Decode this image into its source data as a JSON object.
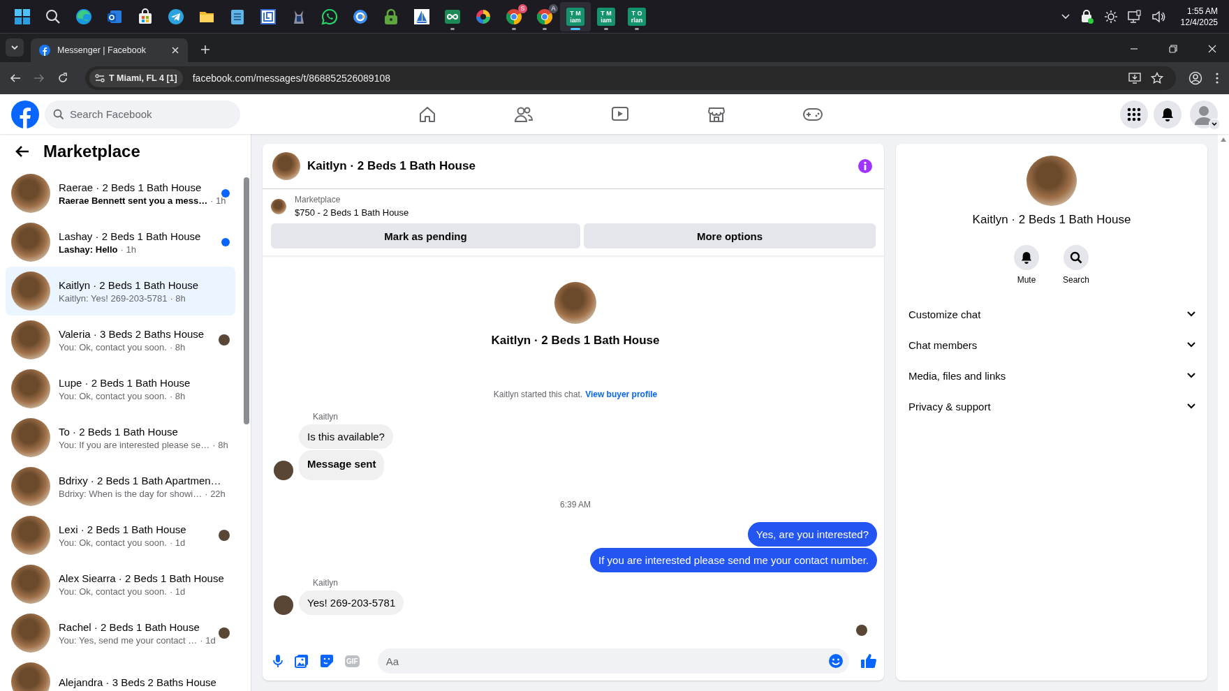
{
  "taskbar": {
    "apps": [
      {
        "kind": "start",
        "selected": false,
        "running": false
      },
      {
        "kind": "search",
        "selected": false,
        "running": false
      },
      {
        "kind": "edge",
        "selected": false,
        "running": false
      },
      {
        "kind": "outlook",
        "selected": false,
        "running": false
      },
      {
        "kind": "store",
        "selected": false,
        "running": false
      },
      {
        "kind": "telegram",
        "selected": false,
        "running": false
      },
      {
        "kind": "files",
        "selected": false,
        "running": false
      },
      {
        "kind": "notepad",
        "selected": false,
        "running": false
      },
      {
        "kind": "maze",
        "selected": false,
        "running": false
      },
      {
        "kind": "mascot",
        "selected": false,
        "running": false
      },
      {
        "kind": "whatsapp",
        "selected": false,
        "running": false
      },
      {
        "kind": "circle-app",
        "selected": false,
        "running": false
      },
      {
        "kind": "vpn",
        "selected": false,
        "running": false
      },
      {
        "kind": "sailboat",
        "selected": false,
        "running": false
      },
      {
        "kind": "loop",
        "selected": false,
        "running": true
      },
      {
        "kind": "color-wheel",
        "selected": false,
        "running": false
      },
      {
        "kind": "chrome",
        "badge": "S",
        "selected": false,
        "running": true
      },
      {
        "kind": "chrome",
        "badge": "A",
        "selected": false,
        "running": true
      },
      {
        "kind": "tile",
        "lines": [
          "T M",
          "iam"
        ],
        "selected": true,
        "running": true
      },
      {
        "kind": "tile",
        "lines": [
          "T M",
          "iam"
        ],
        "selected": false,
        "running": true
      },
      {
        "kind": "tile",
        "lines": [
          "T O",
          "rlan"
        ],
        "selected": false,
        "running": true
      }
    ],
    "time": "1:55 AM",
    "date": "12/4/2025"
  },
  "browser": {
    "tab_title": "Messenger | Facebook",
    "site_chip": "T Miami, FL 4 [1]",
    "url": "facebook.com/messages/t/868852526089108"
  },
  "facebook": {
    "search": {
      "placeholder": "Search Facebook"
    }
  },
  "sidebar": {
    "title": "Marketplace",
    "conversations": [
      {
        "name": "Raerae · 2 Beds 1 Bath House",
        "preview": "Raerae Bennett sent you a mess…",
        "time": "· 1h",
        "unread": true,
        "seen": false,
        "selected": false
      },
      {
        "name": "Lashay · 2 Beds 1 Bath House",
        "preview": "Lashay: Hello",
        "time": "· 1h",
        "unread": true,
        "seen": false,
        "selected": false
      },
      {
        "name": "Kaitlyn · 2 Beds 1 Bath House",
        "preview": "Kaitlyn: Yes! 269-203-5781",
        "time": "· 8h",
        "unread": false,
        "seen": false,
        "selected": true
      },
      {
        "name": "Valeria · 3 Beds 2 Baths House",
        "preview": "You: Ok, contact you soon.",
        "time": "· 8h",
        "unread": false,
        "seen": true,
        "selected": false
      },
      {
        "name": "Lupe · 2 Beds 1 Bath House",
        "preview": "You: Ok, contact you soon.",
        "time": "· 8h",
        "unread": false,
        "seen": false,
        "selected": false
      },
      {
        "name": "To · 2 Beds 1 Bath House",
        "preview": "You: If you are interested please se…",
        "time": "· 8h",
        "unread": false,
        "seen": false,
        "selected": false
      },
      {
        "name": "Bdrixy · 2 Beds 1 Bath Apartmen…",
        "preview": "Bdrixy: When is the day for showi…",
        "time": "· 22h",
        "unread": false,
        "seen": false,
        "selected": false
      },
      {
        "name": "Lexi · 2 Beds 1 Bath House",
        "preview": "You: Ok, contact you soon.",
        "time": "· 1d",
        "unread": false,
        "seen": true,
        "selected": false
      },
      {
        "name": "Alex Siearra · 2 Beds 1 Bath House",
        "preview": "You: Ok, contact you soon.",
        "time": "· 1d",
        "unread": false,
        "seen": false,
        "selected": false
      },
      {
        "name": "Rachel · 2 Beds 1 Bath House",
        "preview": "You: Yes, send me your contact …",
        "time": "· 1d",
        "unread": false,
        "seen": true,
        "selected": false
      },
      {
        "name": "Alejandra · 3 Beds 2 Baths House",
        "selected": false
      }
    ]
  },
  "chat": {
    "title": "Kaitlyn · 2 Beds 1 Bath House",
    "listing": {
      "label": "Marketplace",
      "title": "$750 - 2 Beds 1 Bath House",
      "buttons": [
        "Mark as pending",
        "More options"
      ]
    },
    "intro": {
      "title": "Kaitlyn · 2 Beds 1 Bath House",
      "note": "Kaitlyn started this chat.",
      "link": "View buyer profile"
    },
    "messages": [
      {
        "kind": "sender",
        "text": "Kaitlyn"
      },
      {
        "kind": "incoming",
        "text": "Is this available?",
        "avatar": false,
        "bold": false
      },
      {
        "kind": "incoming",
        "text": "Message sent",
        "avatar": true,
        "bold": true
      },
      {
        "kind": "time",
        "text": "6:39 AM"
      },
      {
        "kind": "outgoing",
        "text": "Yes, are you interested?"
      },
      {
        "kind": "outgoing",
        "text": "If you are interested please send me your contact number."
      },
      {
        "kind": "sender",
        "text": "Kaitlyn"
      },
      {
        "kind": "incoming",
        "text": "Yes! 269-203-5781",
        "avatar": true,
        "bold": false
      },
      {
        "kind": "seen"
      }
    ],
    "composer": {
      "placeholder": "Aa",
      "gif": "GIF"
    }
  },
  "details": {
    "title": "Kaitlyn · 2 Beds 1 Bath House",
    "actions": [
      {
        "kind": "bell",
        "label": "Mute"
      },
      {
        "kind": "search",
        "label": "Search"
      }
    ],
    "sections": [
      "Customize chat",
      "Chat members",
      "Media, files and links",
      "Privacy & support"
    ]
  }
}
